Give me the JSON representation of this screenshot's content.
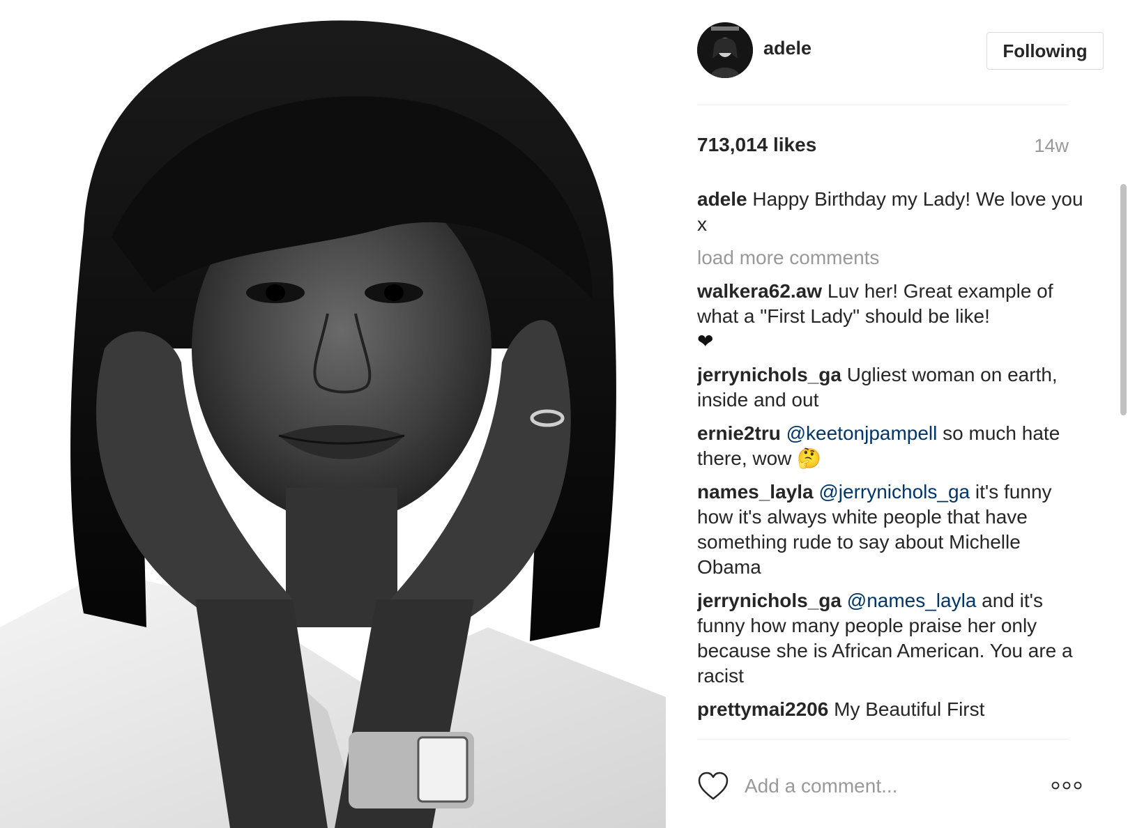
{
  "post": {
    "photo_icon": "portrait-photo"
  },
  "header": {
    "username": "adele",
    "follow_label": "Following",
    "avatar_icon": "avatar-photo"
  },
  "stats": {
    "likes": "713,014 likes",
    "time": "14w"
  },
  "caption": {
    "author": "adele",
    "text": "Happy Birthday my Lady! We love you x"
  },
  "load_more": "load more comments",
  "comments": [
    {
      "author": "walkera62.aw",
      "text": "Luv her! Great example of what a \"First Lady\" should be like!",
      "extra": "❤"
    },
    {
      "author": "jerrynichols_ga",
      "text": "Ugliest woman on earth, inside and out"
    },
    {
      "author": "ernie2tru",
      "mention": "@keetonjpampell",
      "text": "so much hate there, wow 🤔"
    },
    {
      "author": "names_layla",
      "mention": "@jerrynichols_ga",
      "text": "it's funny how it's always white people that have something rude to say about Michelle Obama"
    },
    {
      "author": "jerrynichols_ga",
      "mention": "@names_layla",
      "text": "and it's funny how many people praise her only because she is African American. You are a racist"
    },
    {
      "author": "prettymai2206",
      "text": "My Beautiful First"
    }
  ],
  "footer": {
    "comment_placeholder": "Add a comment...",
    "like_icon": "heart-outline-icon",
    "more_icon": "more-options-icon"
  },
  "colors": {
    "text": "#262626",
    "muted": "#999999",
    "mention": "#003569",
    "border": "#dbdbdb"
  }
}
